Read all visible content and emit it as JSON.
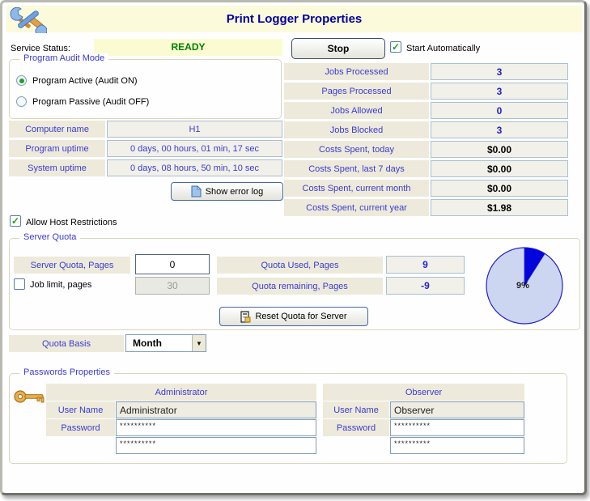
{
  "window": {
    "title": "Print Logger Properties"
  },
  "icons": {
    "check": "✓",
    "dropdown_arrow": "▼"
  },
  "service": {
    "label": "Service Status:",
    "status": "READY",
    "stop_button": "Stop",
    "start_auto_label": "Start Automatically",
    "start_auto_checked": true
  },
  "audit_mode": {
    "title": "Program Audit Mode",
    "option_on": {
      "label": "Program Active (Audit ON)",
      "selected": true
    },
    "option_off": {
      "label": "Program Passive (Audit OFF)",
      "selected": false
    }
  },
  "info": {
    "rows": [
      {
        "label": "Computer name",
        "value": "H1"
      },
      {
        "label": "Program uptime",
        "value": "0 days, 00 hours, 01 min,  17 sec"
      },
      {
        "label": "System uptime",
        "value": "0 days, 08 hours, 50 min,  10 sec"
      }
    ],
    "show_error_log": "Show error log"
  },
  "stats": {
    "rows": [
      {
        "label": "Jobs Processed",
        "value": "3"
      },
      {
        "label": "Pages Processed",
        "value": "3"
      },
      {
        "label": "Jobs Allowed",
        "value": "0"
      },
      {
        "label": "Jobs Blocked",
        "value": "3"
      },
      {
        "label": "Costs Spent, today",
        "value": "$0.00"
      },
      {
        "label": "Costs Spent, last 7 days",
        "value": "$0.00"
      },
      {
        "label": "Costs Spent, current month",
        "value": "$0.00"
      },
      {
        "label": "Costs Spent, current year",
        "value": "$1.98"
      }
    ]
  },
  "host_restrictions": {
    "label": "Allow Host Restrictions",
    "checked": true
  },
  "server_quota": {
    "title": "Server Quota",
    "quota_label": "Server Quota, Pages",
    "quota_value": "0",
    "job_limit_label": "Job limit, pages",
    "job_limit_checked": false,
    "job_limit_value": "30",
    "used_label": "Quota Used, Pages",
    "used_value": "9",
    "remaining_label": "Quota remaining, Pages",
    "remaining_value": "-9",
    "reset_button": "Reset Quota for Server",
    "pie": {
      "percent": 9,
      "label": "9%",
      "used_color": "#0404dd",
      "free_color": "#ccd6f0",
      "border_color": "#2121cc"
    }
  },
  "quota_basis": {
    "label": "Quota Basis",
    "value": "Month"
  },
  "passwords": {
    "title": "Passwords Properties",
    "admin": {
      "header": "Administrator",
      "user_label": "User Name",
      "user_value": "Administrator",
      "pass_label": "Password",
      "password_mask": "**********",
      "confirm_mask": "**********"
    },
    "observer": {
      "header": "Observer",
      "user_label": "User Name",
      "user_value": "Observer",
      "pass_label": "Password",
      "password_mask": "**********",
      "confirm_mask": "**********"
    }
  },
  "colors": {
    "header_bg": "#fbfbdc",
    "title_text": "#0000a0",
    "status_green": "#008000",
    "label_bg": "#edeadb",
    "label_blue": "#3b3bd1",
    "value_bg": "#f1f0e9",
    "value_border": "#aabfd4",
    "group_border": "#d7d7bd"
  }
}
